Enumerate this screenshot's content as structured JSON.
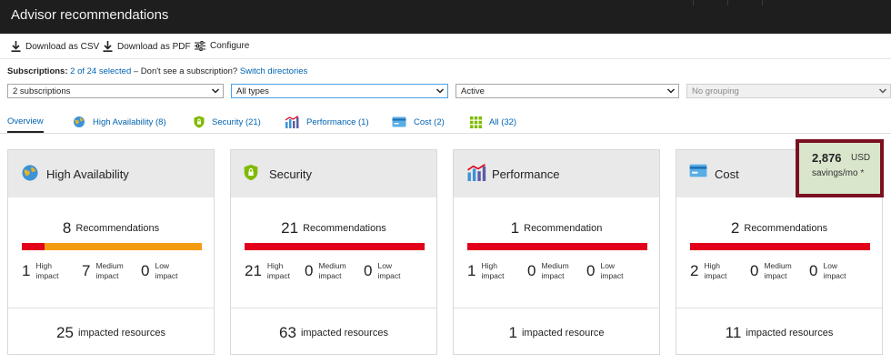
{
  "window": {
    "title": "Advisor recommendations"
  },
  "toolbar": {
    "download_csv": "Download as CSV",
    "download_pdf": "Download as PDF",
    "configure": "Configure"
  },
  "subscriptions": {
    "label": "Subscriptions:",
    "selected_link": "2 of 24 selected",
    "question": " – Don't see a subscription?",
    "switch_link": "Switch directories"
  },
  "filters": {
    "subscriptions": "2 subscriptions",
    "types": "All types",
    "status": "Active",
    "grouping": "No grouping"
  },
  "tabs": [
    {
      "label": "Overview",
      "icon": "none"
    },
    {
      "label": "High Availability (8)",
      "icon": "globe-icon"
    },
    {
      "label": "Security (21)",
      "icon": "shield-icon"
    },
    {
      "label": "Performance (1)",
      "icon": "bar-chart-icon"
    },
    {
      "label": "Cost (2)",
      "icon": "card-icon"
    },
    {
      "label": "All (32)",
      "icon": "grid-icon"
    }
  ],
  "colors": {
    "high": "#e2001a",
    "medium": "#f39c12",
    "accent": "#0063b1",
    "savings_border": "#7a1020",
    "savings_bg": "#d9e6cc"
  },
  "cards": [
    {
      "title": "High Availability",
      "icon": "globe-icon",
      "rec_count": "8",
      "rec_label": "Recommendations",
      "impact": {
        "high": "1",
        "medium": "7",
        "low": "0"
      },
      "bar": {
        "high": 1,
        "medium": 7,
        "low": 0
      },
      "resources_count": "25",
      "resources_label": "impacted resources"
    },
    {
      "title": "Security",
      "icon": "shield-icon",
      "rec_count": "21",
      "rec_label": "Recommendations",
      "impact": {
        "high": "21",
        "medium": "0",
        "low": "0"
      },
      "bar": {
        "high": 21,
        "medium": 0,
        "low": 0
      },
      "resources_count": "63",
      "resources_label": "impacted resources"
    },
    {
      "title": "Performance",
      "icon": "bar-chart-icon",
      "rec_count": "1",
      "rec_label": "Recommendation",
      "impact": {
        "high": "1",
        "medium": "0",
        "low": "0"
      },
      "bar": {
        "high": 1,
        "medium": 0,
        "low": 0
      },
      "resources_count": "1",
      "resources_label": "impacted resource"
    },
    {
      "title": "Cost",
      "icon": "card-icon",
      "rec_count": "2",
      "rec_label": "Recommendations",
      "impact": {
        "high": "2",
        "medium": "0",
        "low": "0"
      },
      "bar": {
        "high": 2,
        "medium": 0,
        "low": 0
      },
      "resources_count": "11",
      "resources_label": "impacted resources"
    }
  ],
  "impact_labels": {
    "high": "High impact",
    "medium": "Medium impact",
    "low": "Low impact"
  },
  "savings": {
    "amount": "2,876",
    "currency": "USD",
    "label": "savings/mo *"
  }
}
